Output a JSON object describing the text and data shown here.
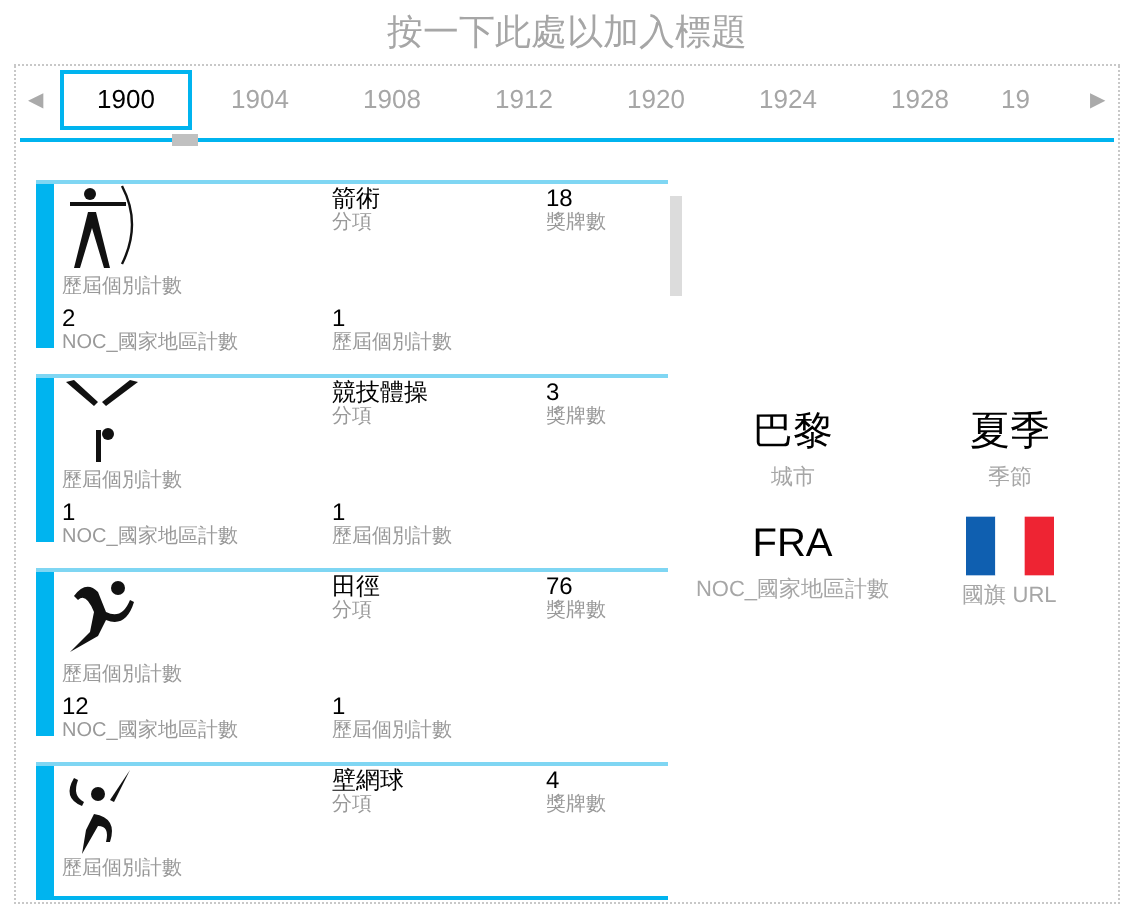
{
  "title": "按一下此處以加入標題",
  "timeline": {
    "prev": "◀",
    "next": "▶",
    "years": [
      {
        "label": "1900",
        "selected": true
      },
      {
        "label": "1904",
        "selected": false
      },
      {
        "label": "1908",
        "selected": false
      },
      {
        "label": "1912",
        "selected": false
      },
      {
        "label": "1920",
        "selected": false
      },
      {
        "label": "1924",
        "selected": false
      },
      {
        "label": "1928",
        "selected": false
      },
      {
        "label": "19",
        "selected": false
      }
    ]
  },
  "cards": [
    {
      "icon_label": "歷屆個別計數",
      "discipline": "箭術",
      "discipline_label": "分項",
      "medals": "18",
      "medals_label": "獎牌數",
      "noc_count": "2",
      "noc_label": "NOC_國家地區計數",
      "count": "1",
      "count_label": "歷屆個別計數"
    },
    {
      "icon_label": "歷屆個別計數",
      "discipline": "競技體操",
      "discipline_label": "分項",
      "medals": "3",
      "medals_label": "獎牌數",
      "noc_count": "1",
      "noc_label": "NOC_國家地區計數",
      "count": "1",
      "count_label": "歷屆個別計數"
    },
    {
      "icon_label": "歷屆個別計數",
      "discipline": "田徑",
      "discipline_label": "分項",
      "medals": "76",
      "medals_label": "獎牌數",
      "noc_count": "12",
      "noc_label": "NOC_國家地區計數",
      "count": "1",
      "count_label": "歷屆個別計數"
    },
    {
      "icon_label": "歷屆個別計數",
      "discipline": "壁網球",
      "discipline_label": "分項",
      "medals": "4",
      "medals_label": "獎牌數"
    }
  ],
  "summary": {
    "city": "巴黎",
    "city_label": "城市",
    "season": "夏季",
    "season_label": "季節",
    "noc": "FRA",
    "noc_label": "NOC_國家地區計數",
    "flag_label": "國旗 URL"
  }
}
